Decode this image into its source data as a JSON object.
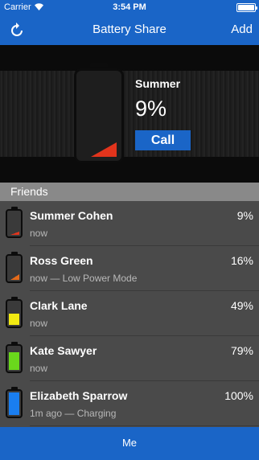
{
  "status_bar": {
    "carrier": "Carrier",
    "time": "3:54 PM",
    "wifi_icon": "wifi-icon",
    "battery_icon": "battery-icon"
  },
  "nav": {
    "title": "Battery Share",
    "refresh_icon": "refresh-icon",
    "add_label": "Add"
  },
  "selected": {
    "name": "Summer",
    "percent": "9%",
    "level": 0.09,
    "call_label": "Call",
    "level_color": "#e2341c"
  },
  "section": {
    "header": "Friends"
  },
  "friends": [
    {
      "name": "Summer Cohen",
      "percent": "9%",
      "status": "now",
      "level": 0.09,
      "color": "#e2341c"
    },
    {
      "name": "Ross Green",
      "percent": "16%",
      "status": "now — Low Power Mode",
      "level": 0.16,
      "color": "#e46a1a"
    },
    {
      "name": "Clark Lane",
      "percent": "49%",
      "status": "now",
      "level": 0.49,
      "color": "#f2ea12"
    },
    {
      "name": "Kate Sawyer",
      "percent": "79%",
      "status": "now",
      "level": 0.79,
      "color": "#6ad81c"
    },
    {
      "name": "Elizabeth Sparrow",
      "percent": "100%",
      "status": "1m ago — Charging",
      "level": 1.0,
      "color": "#1a7ef0"
    }
  ],
  "tab_bar": {
    "label": "Me"
  },
  "colors": {
    "accent": "#1a65c7",
    "row_bg": "#4a4a4a",
    "header_bg": "#898989"
  }
}
